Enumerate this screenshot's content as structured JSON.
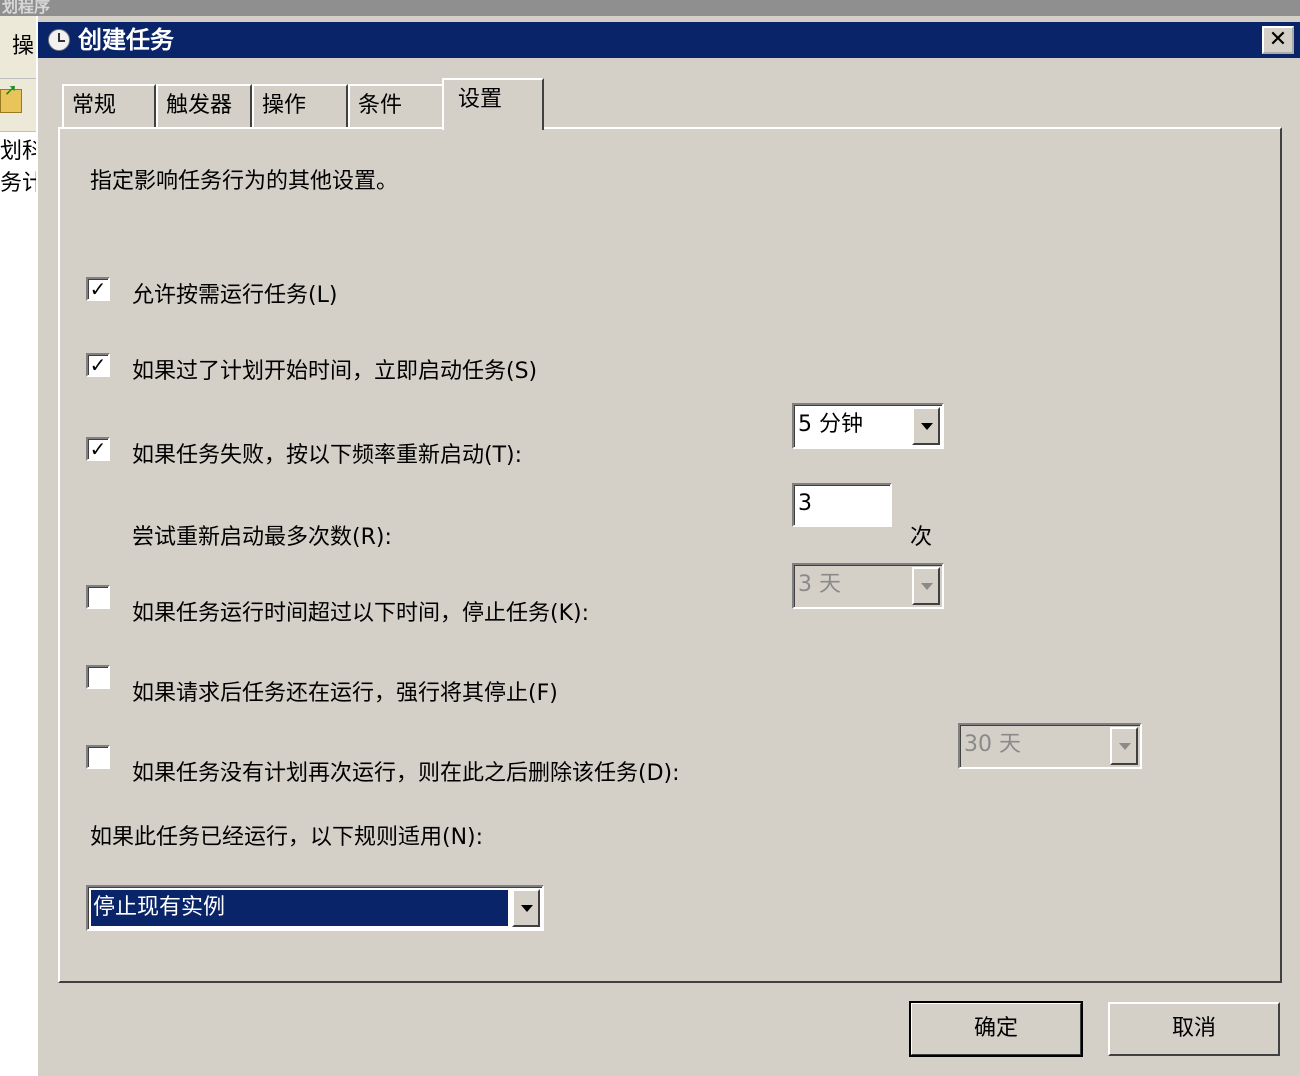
{
  "background_app": {
    "title": "划程序",
    "menu_label": "操",
    "tree_items": [
      "划科",
      "务计"
    ]
  },
  "dialog": {
    "title": "创建任务",
    "close_label": "✕"
  },
  "tabs": [
    {
      "label": "常规",
      "active": false
    },
    {
      "label": "触发器",
      "active": false
    },
    {
      "label": "操作",
      "active": false
    },
    {
      "label": "条件",
      "active": false
    },
    {
      "label": "设置",
      "active": true
    }
  ],
  "settings": {
    "description": "指定影响任务行为的其他设置。",
    "allow_on_demand": {
      "label": "允许按需运行任务(L)",
      "checked": true
    },
    "start_if_missed": {
      "label": "如果过了计划开始时间，立即启动任务(S)",
      "checked": true
    },
    "restart_on_fail": {
      "label": "如果任务失败，按以下频率重新启动(T):",
      "checked": true,
      "interval": "5 分钟"
    },
    "restart_attempts": {
      "label": "尝试重新启动最多次数(R):",
      "value": "3",
      "unit": "次"
    },
    "stop_if_runs_longer": {
      "label": "如果任务运行时间超过以下时间，停止任务(K):",
      "checked": false,
      "duration": "3 天"
    },
    "force_stop": {
      "label": "如果请求后任务还在运行，强行将其停止(F)",
      "checked": false
    },
    "delete_if_not_scheduled": {
      "label": "如果任务没有计划再次运行，则在此之后删除该任务(D):",
      "checked": false,
      "duration": "30 天"
    },
    "rule_label": "如果此任务已经运行，以下规则适用(N):",
    "rule_value": "停止现有实例"
  },
  "buttons": {
    "ok": "确定",
    "cancel": "取消"
  },
  "colors": {
    "titlebar": "#0a246a",
    "face": "#d4d0c8",
    "selection": "#0a246a"
  }
}
